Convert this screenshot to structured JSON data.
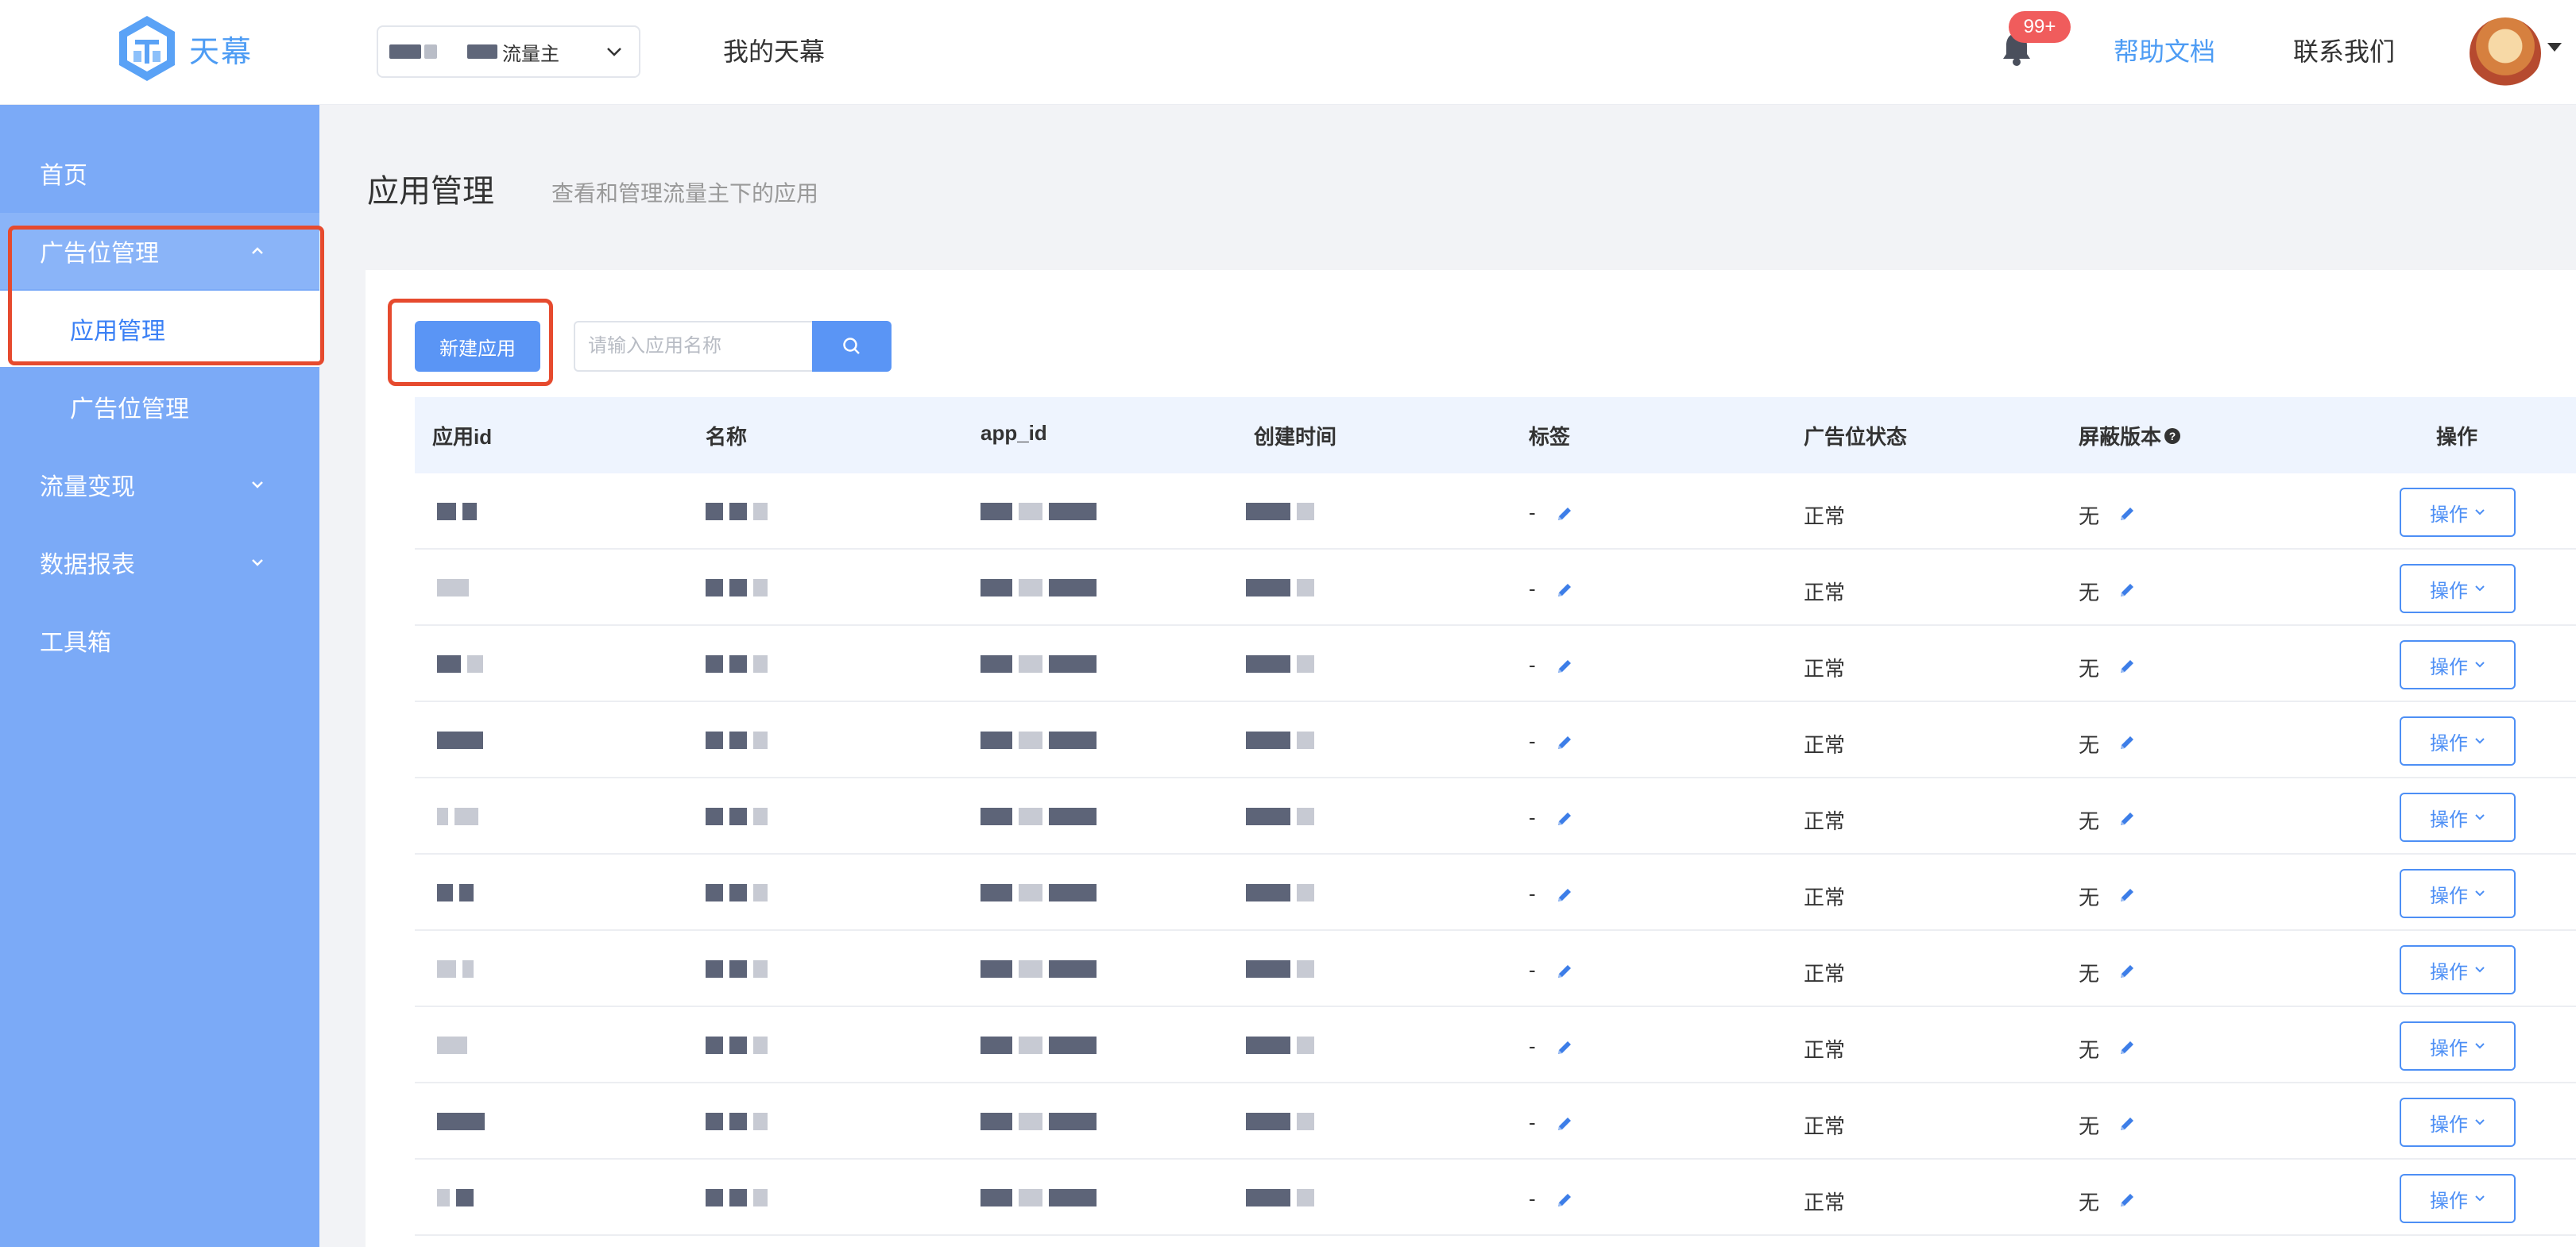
{
  "header": {
    "logo_text": "天幕",
    "account_role": "流量主",
    "nav_mine": "我的天幕",
    "notification_count": "99+",
    "help_docs": "帮助文档",
    "contact_us": "联系我们"
  },
  "sidebar": {
    "items": [
      {
        "label": "首页"
      },
      {
        "label": "广告位管理"
      },
      {
        "label": "应用管理"
      },
      {
        "label": "广告位管理"
      },
      {
        "label": "流量变现"
      },
      {
        "label": "数据报表"
      },
      {
        "label": "工具箱"
      }
    ]
  },
  "main": {
    "title": "应用管理",
    "subtitle": "查看和管理流量主下的应用",
    "new_app_button": "新建应用",
    "search_placeholder": "请输入应用名称"
  },
  "table": {
    "columns": [
      "应用id",
      "名称",
      "app_id",
      "创建时间",
      "标签",
      "广告位状态",
      "屏蔽版本",
      "操作"
    ],
    "rows": [
      {
        "tag": "-",
        "status": "正常",
        "block": "无",
        "op": "操作"
      },
      {
        "tag": "-",
        "status": "正常",
        "block": "无",
        "op": "操作"
      },
      {
        "tag": "-",
        "status": "正常",
        "block": "无",
        "op": "操作"
      },
      {
        "tag": "-",
        "status": "正常",
        "block": "无",
        "op": "操作"
      },
      {
        "tag": "-",
        "status": "正常",
        "block": "无",
        "op": "操作"
      },
      {
        "tag": "-",
        "status": "正常",
        "block": "无",
        "op": "操作"
      },
      {
        "tag": "-",
        "status": "正常",
        "block": "无",
        "op": "操作"
      },
      {
        "tag": "-",
        "status": "正常",
        "block": "无",
        "op": "操作"
      },
      {
        "tag": "-",
        "status": "正常",
        "block": "无",
        "op": "操作"
      },
      {
        "tag": "-",
        "status": "正常",
        "block": "无",
        "op": "操作"
      }
    ]
  },
  "colors": {
    "accent": "#4d9cf4",
    "sidebar": "#7baaf7",
    "highlight": "#e64a2e",
    "badge": "#f05c5c"
  },
  "icons": [
    "logo-icon",
    "chevron-down-icon",
    "bell-icon",
    "avatar",
    "chevron-up-icon",
    "search-icon",
    "pencil-icon",
    "help-circle-icon"
  ]
}
